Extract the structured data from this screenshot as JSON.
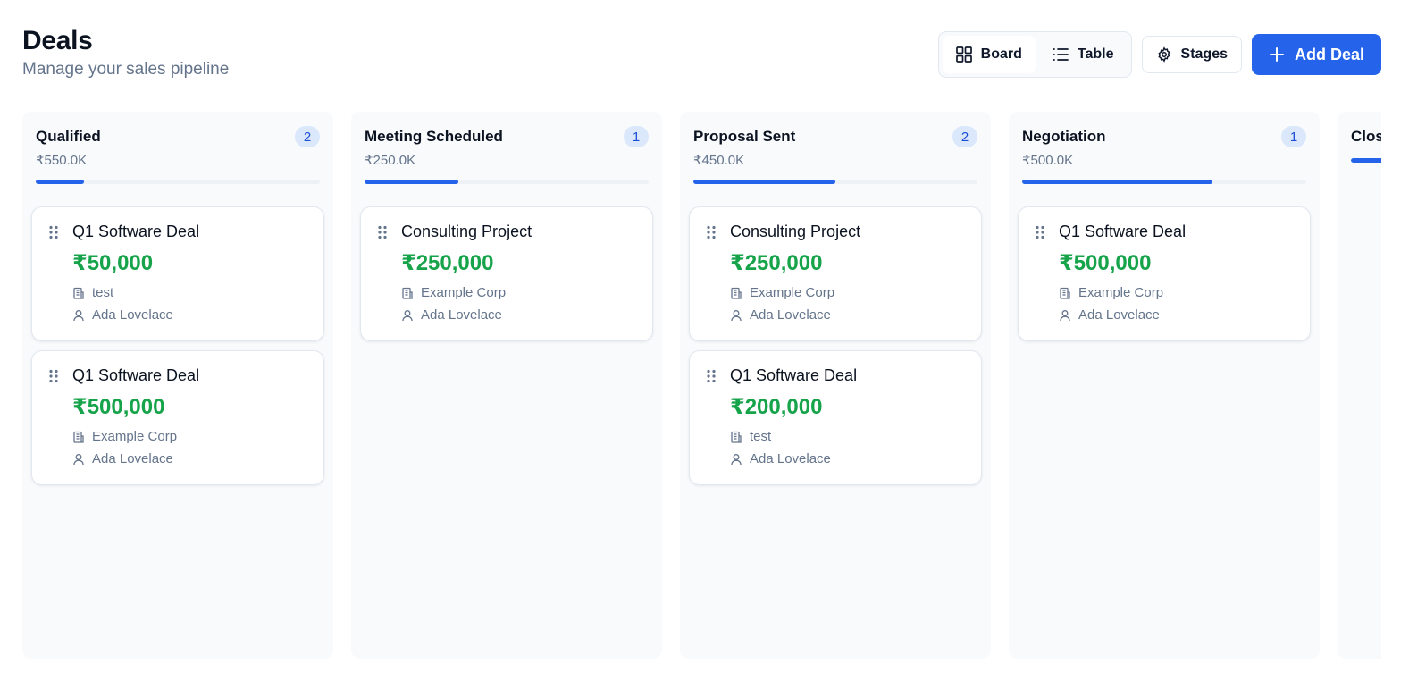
{
  "header": {
    "title": "Deals",
    "subtitle": "Manage your sales pipeline"
  },
  "toolbar": {
    "board_label": "Board",
    "table_label": "Table",
    "stages_label": "Stages",
    "add_label": "Add Deal",
    "active_view": "Board"
  },
  "colors": {
    "accent": "#2563eb",
    "amount": "#16a34a",
    "muted": "#64748b"
  },
  "columns": [
    {
      "name": "Qualified",
      "count": "2",
      "total": "₹550.0K",
      "progress": 0.17,
      "cards": [
        {
          "title": "Q1 Software Deal",
          "amount": "₹50,000",
          "company": "test",
          "owner": "Ada Lovelace"
        },
        {
          "title": "Q1 Software Deal",
          "amount": "₹500,000",
          "company": "Example Corp",
          "owner": "Ada Lovelace"
        }
      ]
    },
    {
      "name": "Meeting Scheduled",
      "count": "1",
      "total": "₹250.0K",
      "progress": 0.33,
      "cards": [
        {
          "title": "Consulting Project",
          "amount": "₹250,000",
          "company": "Example Corp",
          "owner": "Ada Lovelace"
        }
      ]
    },
    {
      "name": "Proposal Sent",
      "count": "2",
      "total": "₹450.0K",
      "progress": 0.5,
      "cards": [
        {
          "title": "Consulting Project",
          "amount": "₹250,000",
          "company": "Example Corp",
          "owner": "Ada Lovelace"
        },
        {
          "title": "Q1 Software Deal",
          "amount": "₹200,000",
          "company": "test",
          "owner": "Ada Lovelace"
        }
      ]
    },
    {
      "name": "Negotiation",
      "count": "1",
      "total": "₹500.0K",
      "progress": 0.67,
      "cards": [
        {
          "title": "Q1 Software Deal",
          "amount": "₹500,000",
          "company": "Example Corp",
          "owner": "Ada Lovelace"
        }
      ]
    },
    {
      "name": "Clos",
      "count": "",
      "total": "",
      "progress": 1.0,
      "cards": []
    }
  ]
}
